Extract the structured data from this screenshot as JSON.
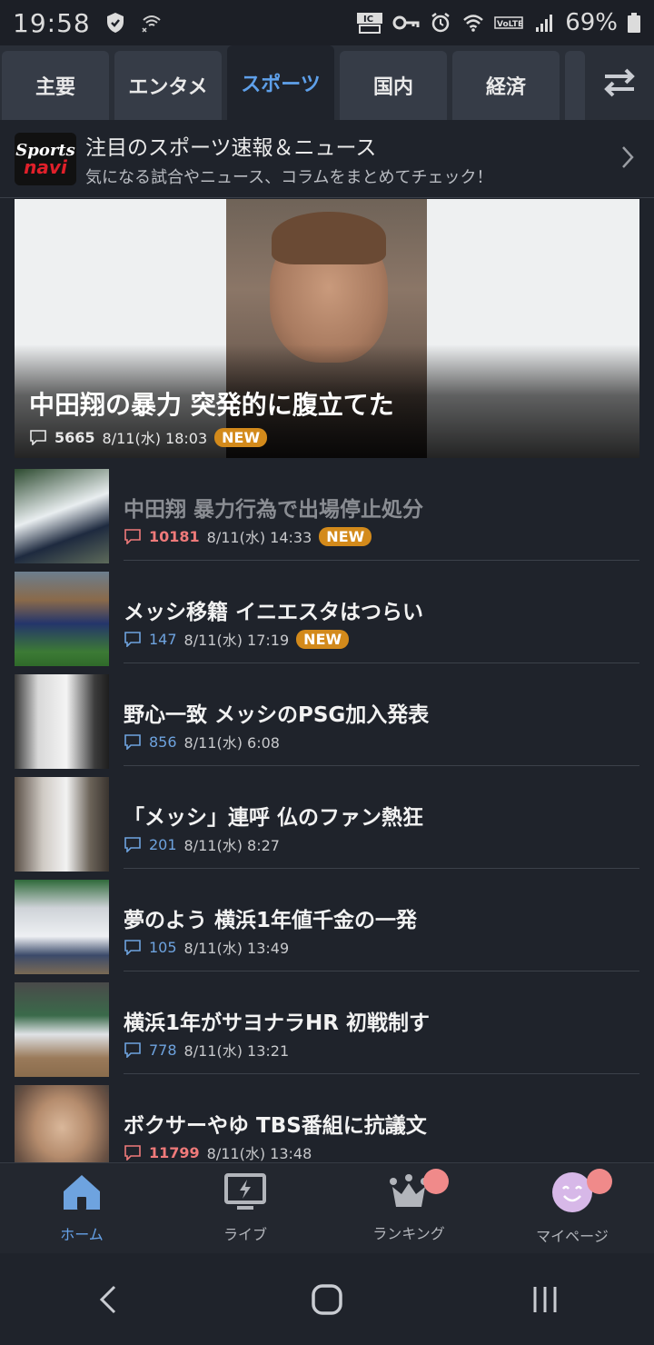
{
  "status_bar": {
    "time": "19:58",
    "battery": "69%",
    "icons": [
      "shield-icon",
      "wifi-x-icon",
      "ic-card-icon",
      "key-icon",
      "alarm-icon",
      "wifi-icon",
      "volte-icon",
      "signal-icon",
      "battery-icon"
    ]
  },
  "tabs": [
    {
      "label": "主要"
    },
    {
      "label": "エンタメ"
    },
    {
      "label": "スポーツ",
      "active": true
    },
    {
      "label": "国内"
    },
    {
      "label": "経済"
    }
  ],
  "promo": {
    "logo_line1": "Sports",
    "logo_line2": "navi",
    "title": "注目のスポーツ速報＆ニュース",
    "subtitle": "気になる試合やニュース、コラムをまとめてチェック！"
  },
  "hero": {
    "title": "中田翔の暴力 突発的に腹立てた",
    "comments": "5665",
    "date": "8/11(水) 18:03",
    "badge": "NEW"
  },
  "articles": [
    {
      "title": "中田翔 暴力行為で出場停止処分",
      "comments": "10181",
      "date": "8/11(水) 14:33",
      "badge": "NEW",
      "read": true,
      "hot": true
    },
    {
      "title": "メッシ移籍 イニエスタはつらい",
      "comments": "147",
      "date": "8/11(水) 17:19",
      "badge": "NEW",
      "read": false,
      "hot": false
    },
    {
      "title": "野心一致 メッシのPSG加入発表",
      "comments": "856",
      "date": "8/11(水) 6:08",
      "badge": "",
      "read": false,
      "hot": false
    },
    {
      "title": "「メッシ」連呼 仏のファン熱狂",
      "comments": "201",
      "date": "8/11(水) 8:27",
      "badge": "",
      "read": false,
      "hot": false
    },
    {
      "title": "夢のよう 横浜1年値千金の一発",
      "comments": "105",
      "date": "8/11(水) 13:49",
      "badge": "",
      "read": false,
      "hot": false
    },
    {
      "title": "横浜1年がサヨナラHR 初戦制す",
      "comments": "778",
      "date": "8/11(水) 13:21",
      "badge": "",
      "read": false,
      "hot": false
    },
    {
      "title": "ボクサーやゆ TBS番組に抗議文",
      "comments": "11799",
      "date": "8/11(水) 13:48",
      "badge": "",
      "read": false,
      "hot": true
    }
  ],
  "bottom_nav": {
    "home": "ホーム",
    "live": "ライブ",
    "ranking": "ランキング",
    "mypage": "マイページ"
  },
  "colors": {
    "background": "#1f232b",
    "accent": "#5ea0ea",
    "badge": "#d38a1b",
    "hot_count": "#ef7a7a",
    "notification_dot": "#f08a8a"
  }
}
